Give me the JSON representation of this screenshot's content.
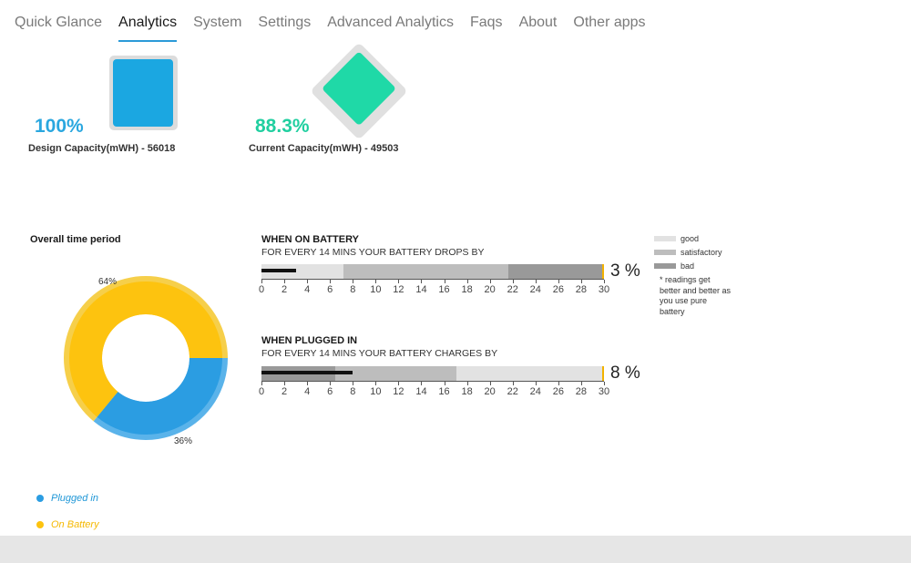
{
  "nav": {
    "items": [
      {
        "label": "Quick Glance",
        "active": false
      },
      {
        "label": "Analytics",
        "active": true
      },
      {
        "label": "System",
        "active": false
      },
      {
        "label": "Settings",
        "active": false
      },
      {
        "label": "Advanced Analytics",
        "active": false
      },
      {
        "label": "Faqs",
        "active": false
      },
      {
        "label": "About",
        "active": false
      },
      {
        "label": "Other apps",
        "active": false
      }
    ]
  },
  "capacity": {
    "design": {
      "percent": "100%",
      "label": "Design Capacity(mWH) - 56018",
      "color": "#1ba7e1"
    },
    "current": {
      "percent": "88.3%",
      "label": "Current Capacity(mWH) - 49503",
      "color": "#1fd9a7"
    }
  },
  "overall": {
    "title": "Overall time period",
    "slices": [
      {
        "name": "On Battery",
        "label": "64%",
        "value": 64,
        "color": "#fdc30f",
        "outer_color": "#f6cf4a"
      },
      {
        "name": "Plugged in",
        "label": "36%",
        "value": 36,
        "color": "#2b9de2",
        "outer_color": "#5ab3ea"
      }
    ],
    "legend": [
      {
        "label": "Plugged in",
        "color": "#1f97d7"
      },
      {
        "label": "On Battery",
        "color": "#f5b800"
      }
    ]
  },
  "meters": {
    "axis_ticks": [
      "0",
      "2",
      "4",
      "6",
      "8",
      "10",
      "12",
      "14",
      "16",
      "18",
      "20",
      "22",
      "24",
      "26",
      "28",
      "30"
    ],
    "axis_max": 30,
    "battery": {
      "title": "WHEN ON BATTERY",
      "subtitle": "FOR EVERY 14 MINS YOUR BATTERY DROPS BY",
      "value": 3,
      "value_label": "3 %",
      "ranges": [
        {
          "level": "good",
          "from": 0,
          "to": 7.2
        },
        {
          "level": "satisfactory",
          "from": 7.2,
          "to": 21.6
        },
        {
          "level": "bad",
          "from": 21.6,
          "to": 30
        }
      ]
    },
    "plugged": {
      "title": "WHEN PLUGGED IN",
      "subtitle": "FOR EVERY 14 MINS YOUR BATTERY CHARGES BY",
      "value": 8,
      "value_label": "8 %",
      "ranges": [
        {
          "level": "bad",
          "from": 0,
          "to": 6.5
        },
        {
          "level": "satisfactory",
          "from": 6.5,
          "to": 17.1
        },
        {
          "level": "good",
          "from": 17.1,
          "to": 30
        }
      ]
    }
  },
  "legend": {
    "items": [
      {
        "label": "good",
        "color": "#e2e2e2"
      },
      {
        "label": "satisfactory",
        "color": "#bdbdbd"
      },
      {
        "label": "bad",
        "color": "#999999"
      }
    ],
    "note": "* readings get better and better as you use pure battery"
  }
}
